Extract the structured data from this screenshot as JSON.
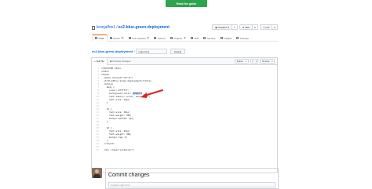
{
  "banner": {
    "read_guide_label": "Read the guide"
  },
  "repo": {
    "owner": "leonjalfon1",
    "name": "ec2-blue-green-deployment"
  },
  "actions": {
    "unwatch": {
      "label": "Unwatch",
      "count": "1"
    },
    "star": {
      "label": "Star",
      "count": "0"
    },
    "fork": {
      "label": "Fork",
      "count": "0"
    }
  },
  "tabs": [
    {
      "label": "Code",
      "icon": "code-icon"
    },
    {
      "label": "Issues",
      "badge": "0",
      "icon": "issue-icon"
    },
    {
      "label": "Pull requests",
      "badge": "0",
      "icon": "pull-request-icon"
    },
    {
      "label": "Actions",
      "icon": "play-icon"
    },
    {
      "label": "Projects",
      "badge": "0",
      "icon": "project-icon"
    },
    {
      "label": "Wiki",
      "icon": "book-icon"
    },
    {
      "label": "Security",
      "icon": "shield-icon"
    },
    {
      "label": "Insights",
      "icon": "graph-icon"
    },
    {
      "label": "Settings",
      "icon": "gear-icon"
    }
  ],
  "path": {
    "repo": "ec2-blue-green-deployment",
    "filename": "index.html",
    "cancel_label": "Cancel"
  },
  "editor": {
    "edit_tab": "Edit file",
    "preview_tab": "Preview changes",
    "indent_mode": "Spaces",
    "indent_size": "2",
    "wrap_mode": "No wrap",
    "lines": [
      "<!DOCTYPE html>",
      "<html>",
      "<head>",
      "  <meta charset=\"utf-8\">",
      "  <title>Blue Green Deployment</title>",
      "  <style>",
      "    body {",
      "      color: #ffffff;",
      "      background-color: #0000ff;",
      "      font-family: Arial, sans-serif;",
      "      font-size: 14px;",
      "    }",
      "",
      "    h1 {",
      "      font-size: 38px;",
      "      font-weight: 300;",
      "      margin-bottom: 4px;",
      "    }",
      "",
      "    h2 {",
      "      font-size: 22px;",
      "      font-weight: 300;",
      "      margin-top: 0;",
      "    }",
      "  </style>",
      "",
      "  <div class=\"container\">"
    ],
    "highlight": {
      "line": 8,
      "prefix": "      background-color: ",
      "token": "#0000ff",
      "suffix": ";"
    }
  },
  "commit": {
    "title": "Commit changes",
    "placeholder": "Update index.html"
  },
  "colors": {
    "accent_green": "#2ea44f",
    "link": "#0366d6",
    "annotation_arrow": "#e02020"
  }
}
